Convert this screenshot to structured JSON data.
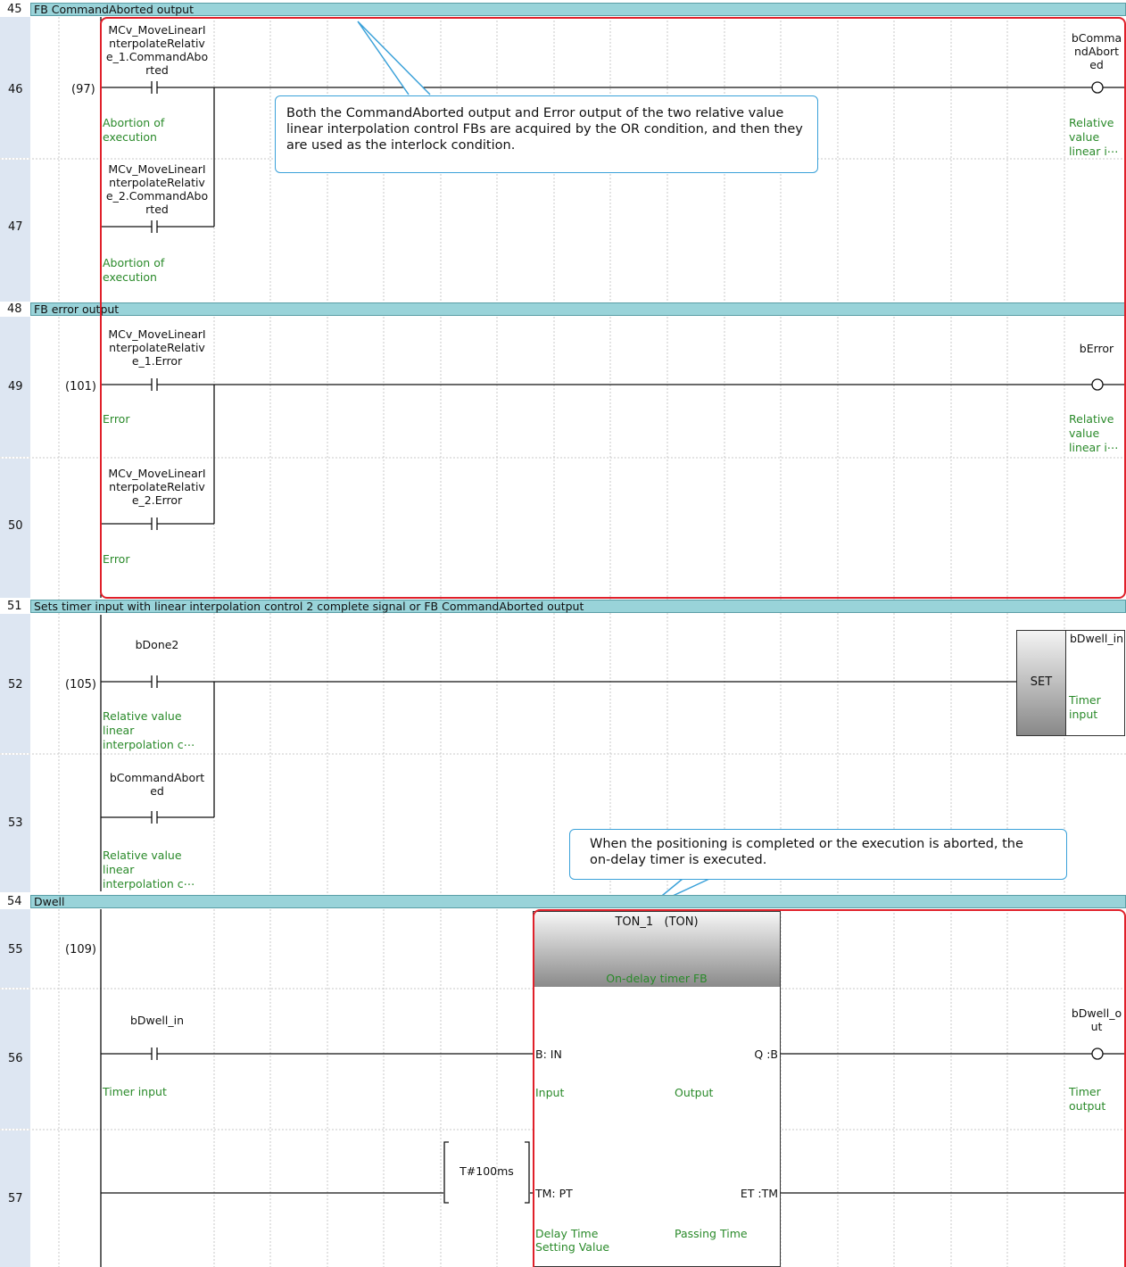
{
  "sections": [
    {
      "num": "45",
      "title": "FB CommandAborted output"
    },
    {
      "num": "48",
      "title": "FB error output"
    },
    {
      "num": "51",
      "title": "Sets timer input with linear interpolation control 2 complete signal or FB CommandAborted output"
    },
    {
      "num": "54",
      "title": "Dwell"
    }
  ],
  "rows": {
    "r46": "46",
    "r47": "47",
    "r49": "49",
    "r50": "50",
    "r52": "52",
    "r53": "53",
    "r55": "55",
    "r56": "56",
    "r57": "57"
  },
  "steps": {
    "s97": "(97)",
    "s101": "(101)",
    "s105": "(105)",
    "s109": "(109)"
  },
  "contacts": {
    "c46": "MCv_MoveLinearI nterpolateRelativ e_1.CommandAbo rted",
    "c47": "MCv_MoveLinearI nterpolateRelativ e_2.CommandAbo rted",
    "c49": "MCv_MoveLinearI nterpolateRelativ e_1.Error",
    "c50": "MCv_MoveLinearI nterpolateRelativ e_2.Error",
    "c52": "bDone2",
    "c53": "bCommandAbort ed",
    "c56": "bDwell_in"
  },
  "contact_comments": {
    "c46": "Abortion of execution",
    "c47": "Abortion of execution",
    "c49": "Error",
    "c50": "Error",
    "c52": "Relative value linear interpolation c⋯",
    "c53": "Relative value linear interpolation c⋯",
    "c56": "Timer input"
  },
  "coils": {
    "o46": "bComma ndAbort ed",
    "o49": "bError",
    "o52": "bDwell_in",
    "o56": "bDwell_o ut"
  },
  "coil_comments": {
    "o46": "Relative value linear i⋯",
    "o49": "Relative value linear i⋯",
    "o52": "Timer input",
    "o56": "Timer output"
  },
  "set_instruction": "SET",
  "timer_fb": {
    "instance": "TON_1   (TON)",
    "comment": "On-delay timer FB",
    "in_pin": "B: IN",
    "in_comment": "Input",
    "q_pin": "Q :B",
    "q_comment": "Output",
    "pt_pin": "TM: PT",
    "pt_comment": "Delay Time Setting Value",
    "et_pin": "ET :TM",
    "et_comment": "Passing Time",
    "pt_value": "T#100ms"
  },
  "callouts": {
    "interlock": "Both the CommandAborted output and Error output of the two relative value linear interpolation control FBs are acquired by the OR condition, and then they are used as the interlock condition.",
    "ondelay": "When the positioning is completed or the execution is aborted, the on-delay timer is executed."
  },
  "colors": {
    "section_bar": "#99d3d9",
    "comment_green": "#2a8a2a",
    "highlight_red": "#e0202a",
    "callout_blue": "#3aa1d9",
    "gutter": "#dde6f2"
  }
}
